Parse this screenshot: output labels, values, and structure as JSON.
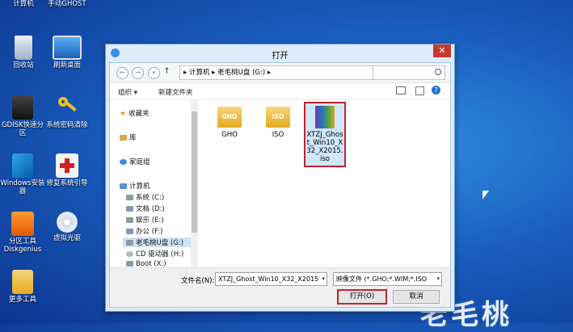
{
  "desktop": {
    "icons": [
      {
        "label": "计算机"
      },
      {
        "label": "手动GHOST"
      },
      {
        "label": "回收站"
      },
      {
        "label": "刷新桌面"
      },
      {
        "label": "GDISK快速分区"
      },
      {
        "label": "系统密码清除"
      },
      {
        "label": "Windows安装器"
      },
      {
        "label": "修复系统引导"
      },
      {
        "label": "分区工具Diskgenius"
      },
      {
        "label": "虚拟光驱"
      },
      {
        "label": "更多工具"
      }
    ],
    "watermark": "老毛桃"
  },
  "dialog": {
    "title": "打开",
    "close": "✕",
    "nav": {
      "back": "←",
      "forward": "→",
      "up": "↑"
    },
    "address": "▸ 计算机 ▸ 老毛桃U盘 (G:) ▸",
    "toolbar": {
      "organize": "组织 ▾",
      "new_folder": "新建文件夹"
    },
    "sidebar": [
      {
        "label": "收藏夹"
      },
      {
        "label": "库"
      },
      {
        "label": "家庭组"
      },
      {
        "label": "计算机"
      },
      {
        "label": "系统 (C:)"
      },
      {
        "label": "文档 (D:)"
      },
      {
        "label": "娱乐 (E:)"
      },
      {
        "label": "办公 (F:)"
      },
      {
        "label": "老毛桃U盘 (G:)"
      },
      {
        "label": "CD 驱动器 (H:)"
      },
      {
        "label": "Boot (X:)"
      }
    ],
    "files": [
      {
        "label": "GHO",
        "icon_text": "GHO"
      },
      {
        "label": "ISO",
        "icon_text": "ISO"
      },
      {
        "label": "XTZJ_Ghost_Win10_X32_X2015.iso"
      }
    ],
    "filename_label": "文件名(N):",
    "filename_value": "XTZJ_Ghost_Win10_X32_X2015",
    "filetype_value": "映像文件 (*.GHO;*.WIM;*.ISO",
    "open_button": "打开(O)",
    "cancel_button": "取消"
  }
}
